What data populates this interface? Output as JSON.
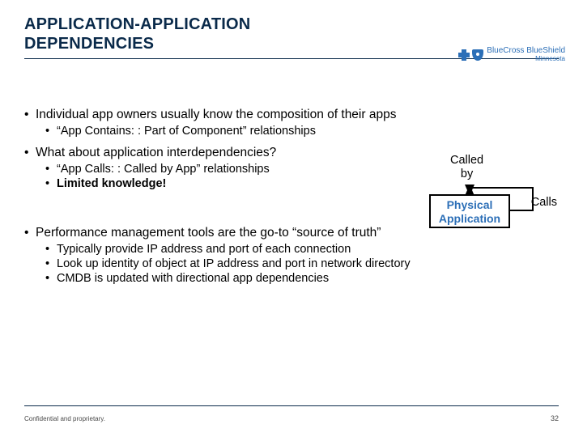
{
  "title_line1": "APPLICATION-APPLICATION",
  "title_line2": "DEPENDENCIES",
  "logo": {
    "main": "BlueCross BlueShield",
    "sub": "Minnesota"
  },
  "bullets": {
    "b1": "Individual app owners usually know the composition of their apps",
    "b1a": "“App Contains: : Part of Component” relationships",
    "b2": "What about application interdependencies?",
    "b2a": "“App Calls: : Called by App” relationships",
    "b2b": "Limited knowledge!",
    "b3": "Performance management tools are the go-to “source of truth”",
    "b3a": "Typically provide IP address and port of each connection",
    "b3b": "Look up identity of object at IP address and port in network directory",
    "b3c": "CMDB is updated with directional app dependencies"
  },
  "diagram": {
    "called_by_line1": "Called",
    "called_by_line2": "by",
    "box_line1": "Physical",
    "box_line2": "Application",
    "calls": "Calls"
  },
  "footer": "Confidential and proprietary.",
  "page": "32"
}
